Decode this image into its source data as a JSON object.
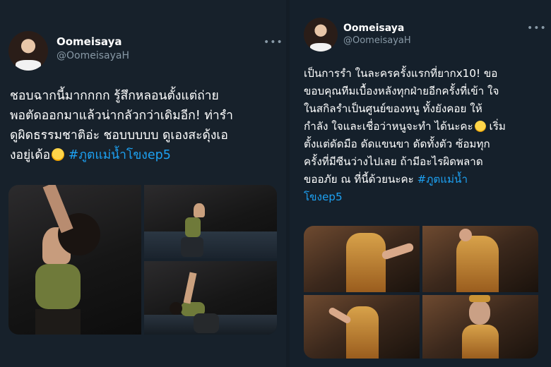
{
  "tweets": [
    {
      "name": "Oomeisaya",
      "handle": "@OomeisayaH",
      "text_lines": [
        "ชอบฉากนี้มากกกก รู้สึกหลอนตั้งแต่ถ่าย",
        "พอตัดออกมาแล้วน่ากลัวกว่าเดิมอีก! ท่ารำ",
        "ดูผิดธรรมชาติอ่ะ ชอบบบบบ ดูเองสะดุ้งเอ",
        "งอยู่เด้อ"
      ],
      "hashtag": "#ภูตแม่น้ำโขงep5",
      "emoji": "rolling-on-floor-laughing"
    },
    {
      "name": "Oomeisaya",
      "handle": "@OomeisayaH",
      "text_lines": [
        "เป็นการรำ ในละครครั้งแรกที่ยากx10! ขอ",
        "ขอบคุณทีมเบื้องหลังทุกฝ่ายอีกครั้งที่เข้า ใจ",
        " ในสกิลรำเป็นศูนย์ของหนู ทั้งยังคอย ให้",
        "กำลัง ใจและเชื่อว่าหนูจะทำ ได้นะคะ",
        "ตั้งแต่ดัดมือ ดัดแขนขา ดัดทั้งตัว ซ้อมทุก",
        "ครั้งที่มีซีนว่างไปเลย ถ้ามีอะไรผิดพลาด",
        "ขออภัย ณ ที่นี้ด้วยนะคะ"
      ],
      "line4_suffix": " เริ่ม",
      "hashtag_part1": "#ภูตแม่น้ำ",
      "hashtag_part2": "โขงep5",
      "emoji": "pleading-face"
    }
  ]
}
